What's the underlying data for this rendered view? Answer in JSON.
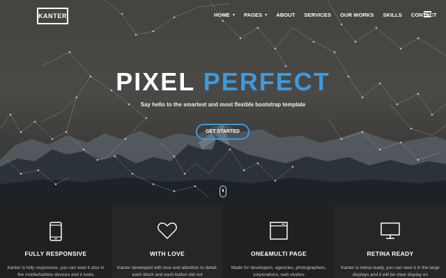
{
  "brand": {
    "logo": "KANTER"
  },
  "nav": {
    "items": [
      {
        "label": "HOME",
        "dropdown": true
      },
      {
        "label": "PAGES",
        "dropdown": true
      },
      {
        "label": "ABOUT",
        "dropdown": false
      },
      {
        "label": "SERVICES",
        "dropdown": false
      },
      {
        "label": "OUR WORKS",
        "dropdown": false
      },
      {
        "label": "SKILLS",
        "dropdown": false
      },
      {
        "label": "CONTACT",
        "dropdown": false
      }
    ],
    "menu_icon": "hamburger-menu-icon"
  },
  "hero": {
    "headline_part1": "PIXEL",
    "headline_part2": "PERFECT",
    "tagline": "Say hello to the smartest and most flexible bootstrap template",
    "cta_label": "GET STARTED",
    "scroll_icon": "scroll-down-icon"
  },
  "features": [
    {
      "icon": "smartphone-icon",
      "title": "FULLY RESPONSIVE",
      "text": "Kanter is fully responsive, you can view it also in the mobile/tablets devices and it looks"
    },
    {
      "icon": "heart-icon",
      "title": "WITH LOVE",
      "text": "Kanter developed with love and attention to detail, each block and each button did not"
    },
    {
      "icon": "browser-window-icon",
      "title": "ONE&MULTI PAGE",
      "text": "Made for developers, agencies, photographers, corporations, web studios"
    },
    {
      "icon": "monitor-icon",
      "title": "RETINA READY",
      "text": "Kanter is retina ready, you can view it in the large displays and it will be clear display on"
    }
  ],
  "colors": {
    "accent": "#3b9ae1",
    "hero_bg": "#4a4845",
    "feature_dark": "#202020",
    "feature_light": "#262626"
  }
}
